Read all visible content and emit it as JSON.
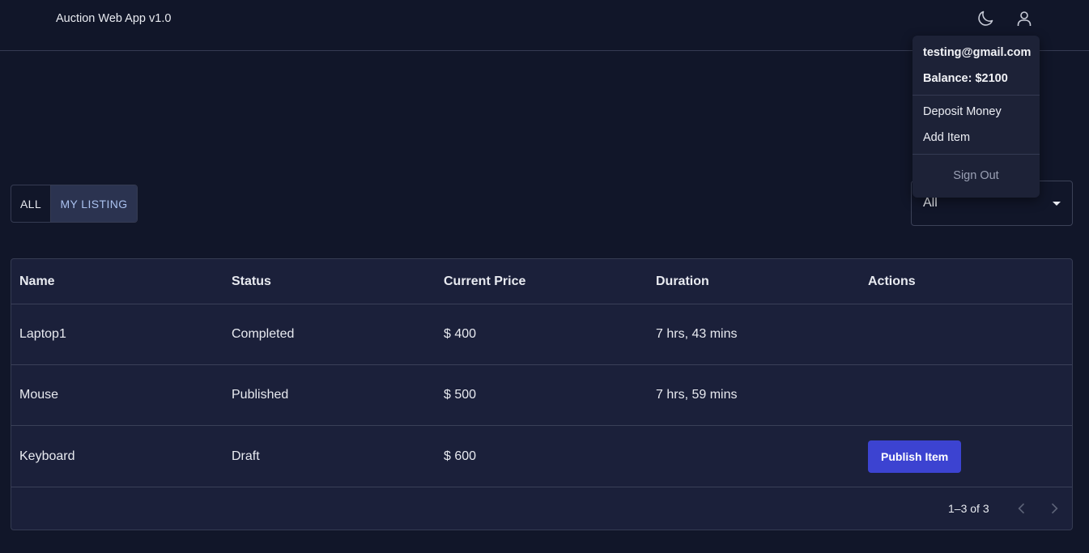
{
  "header": {
    "title": "Auction Web App v1.0",
    "icons": [
      "moon-icon",
      "user-icon"
    ]
  },
  "user_menu": {
    "email": "testing@gmail.com",
    "balance": "Balance: $2100",
    "items": [
      {
        "label": "Deposit Money"
      },
      {
        "label": "Add Item"
      }
    ],
    "sign_out": "Sign Out"
  },
  "filters": {
    "toggle": [
      {
        "label": "ALL",
        "selected": false
      },
      {
        "label": "MY LISTING",
        "selected": true
      }
    ],
    "status_select": {
      "value": "All"
    }
  },
  "table": {
    "columns": [
      "Name",
      "Status",
      "Current Price",
      "Duration",
      "Actions"
    ],
    "rows": [
      {
        "name": "Laptop1",
        "status": "Completed",
        "price": "$ 400",
        "duration": "7 hrs, 43 mins",
        "action": ""
      },
      {
        "name": "Mouse",
        "status": "Published",
        "price": "$ 500",
        "duration": "7 hrs, 59 mins",
        "action": ""
      },
      {
        "name": "Keyboard",
        "status": "Draft",
        "price": "$ 600",
        "duration": "",
        "action": "Publish Item"
      }
    ],
    "pagination": {
      "range": "1–3 of 3"
    }
  },
  "colors": {
    "background": "#111629",
    "surface": "#1b203a",
    "accent": "#3c43d1",
    "selected_toggle_text": "#a9c0ee"
  }
}
